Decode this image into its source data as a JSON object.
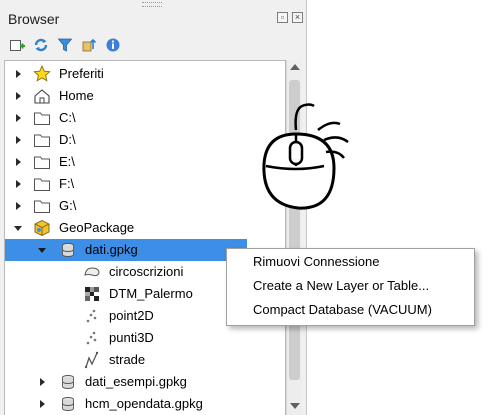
{
  "panel": {
    "title": "Browser",
    "title_buttons": [
      "float-icon",
      "close-icon"
    ],
    "toolbar": [
      "add-selected-layers-icon",
      "refresh-icon",
      "filter-icon",
      "collapse-all-icon",
      "properties-icon"
    ]
  },
  "tree": {
    "items": [
      {
        "label": "Preferiti",
        "icon": "star-icon"
      },
      {
        "label": "Home",
        "icon": "home-icon"
      },
      {
        "label": "C:\\",
        "icon": "folder-icon"
      },
      {
        "label": "D:\\",
        "icon": "folder-icon"
      },
      {
        "label": "E:\\",
        "icon": "folder-icon"
      },
      {
        "label": "F:\\",
        "icon": "folder-icon"
      },
      {
        "label": "G:\\",
        "icon": "folder-icon"
      },
      {
        "label": "GeoPackage",
        "icon": "geopackage-icon"
      },
      {
        "label": "dati.gpkg",
        "icon": "database-icon"
      },
      {
        "label": "circoscrizioni",
        "icon": "polygon-layer-icon"
      },
      {
        "label": "DTM_Palermo",
        "icon": "raster-layer-icon"
      },
      {
        "label": "point2D",
        "icon": "point-layer-icon"
      },
      {
        "label": "punti3D",
        "icon": "point-layer-icon"
      },
      {
        "label": "strade",
        "icon": "line-layer-icon"
      },
      {
        "label": "dati_esempi.gpkg",
        "icon": "database-icon"
      },
      {
        "label": "hcm_opendata.gpkg",
        "icon": "database-icon"
      }
    ]
  },
  "context_menu": {
    "items": [
      "Rimuovi Connessione",
      "Create a New Layer or Table...",
      "Compact Database (VACUUM)"
    ]
  },
  "colors": {
    "selection": "#3d8ee6",
    "panel_bg": "#f0f0f0",
    "accent_refresh": "#2f7fd1",
    "accent_filter": "#3b8ede"
  },
  "overlay": {
    "icon": "right-click-mouse-icon"
  }
}
